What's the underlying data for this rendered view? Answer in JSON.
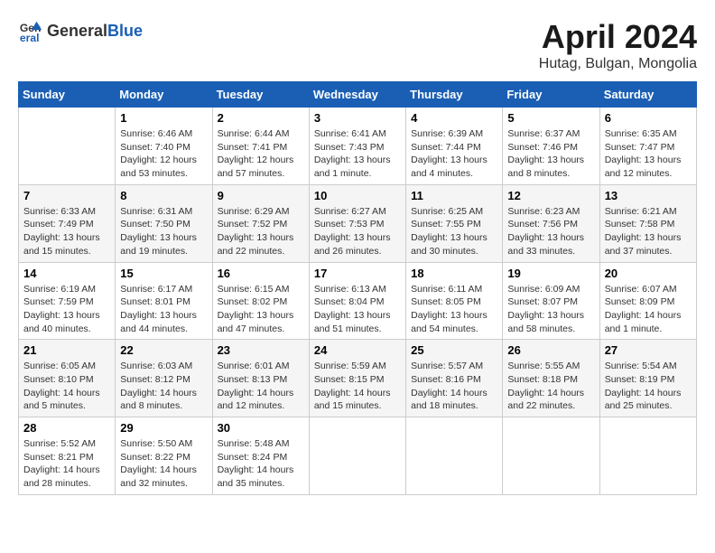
{
  "header": {
    "logo_general": "General",
    "logo_blue": "Blue",
    "month": "April 2024",
    "location": "Hutag, Bulgan, Mongolia"
  },
  "weekdays": [
    "Sunday",
    "Monday",
    "Tuesday",
    "Wednesday",
    "Thursday",
    "Friday",
    "Saturday"
  ],
  "weeks": [
    [
      {
        "day": null,
        "sunrise": null,
        "sunset": null,
        "daylight": null
      },
      {
        "day": "1",
        "sunrise": "Sunrise: 6:46 AM",
        "sunset": "Sunset: 7:40 PM",
        "daylight": "Daylight: 12 hours and 53 minutes."
      },
      {
        "day": "2",
        "sunrise": "Sunrise: 6:44 AM",
        "sunset": "Sunset: 7:41 PM",
        "daylight": "Daylight: 12 hours and 57 minutes."
      },
      {
        "day": "3",
        "sunrise": "Sunrise: 6:41 AM",
        "sunset": "Sunset: 7:43 PM",
        "daylight": "Daylight: 13 hours and 1 minute."
      },
      {
        "day": "4",
        "sunrise": "Sunrise: 6:39 AM",
        "sunset": "Sunset: 7:44 PM",
        "daylight": "Daylight: 13 hours and 4 minutes."
      },
      {
        "day": "5",
        "sunrise": "Sunrise: 6:37 AM",
        "sunset": "Sunset: 7:46 PM",
        "daylight": "Daylight: 13 hours and 8 minutes."
      },
      {
        "day": "6",
        "sunrise": "Sunrise: 6:35 AM",
        "sunset": "Sunset: 7:47 PM",
        "daylight": "Daylight: 13 hours and 12 minutes."
      }
    ],
    [
      {
        "day": "7",
        "sunrise": "Sunrise: 6:33 AM",
        "sunset": "Sunset: 7:49 PM",
        "daylight": "Daylight: 13 hours and 15 minutes."
      },
      {
        "day": "8",
        "sunrise": "Sunrise: 6:31 AM",
        "sunset": "Sunset: 7:50 PM",
        "daylight": "Daylight: 13 hours and 19 minutes."
      },
      {
        "day": "9",
        "sunrise": "Sunrise: 6:29 AM",
        "sunset": "Sunset: 7:52 PM",
        "daylight": "Daylight: 13 hours and 22 minutes."
      },
      {
        "day": "10",
        "sunrise": "Sunrise: 6:27 AM",
        "sunset": "Sunset: 7:53 PM",
        "daylight": "Daylight: 13 hours and 26 minutes."
      },
      {
        "day": "11",
        "sunrise": "Sunrise: 6:25 AM",
        "sunset": "Sunset: 7:55 PM",
        "daylight": "Daylight: 13 hours and 30 minutes."
      },
      {
        "day": "12",
        "sunrise": "Sunrise: 6:23 AM",
        "sunset": "Sunset: 7:56 PM",
        "daylight": "Daylight: 13 hours and 33 minutes."
      },
      {
        "day": "13",
        "sunrise": "Sunrise: 6:21 AM",
        "sunset": "Sunset: 7:58 PM",
        "daylight": "Daylight: 13 hours and 37 minutes."
      }
    ],
    [
      {
        "day": "14",
        "sunrise": "Sunrise: 6:19 AM",
        "sunset": "Sunset: 7:59 PM",
        "daylight": "Daylight: 13 hours and 40 minutes."
      },
      {
        "day": "15",
        "sunrise": "Sunrise: 6:17 AM",
        "sunset": "Sunset: 8:01 PM",
        "daylight": "Daylight: 13 hours and 44 minutes."
      },
      {
        "day": "16",
        "sunrise": "Sunrise: 6:15 AM",
        "sunset": "Sunset: 8:02 PM",
        "daylight": "Daylight: 13 hours and 47 minutes."
      },
      {
        "day": "17",
        "sunrise": "Sunrise: 6:13 AM",
        "sunset": "Sunset: 8:04 PM",
        "daylight": "Daylight: 13 hours and 51 minutes."
      },
      {
        "day": "18",
        "sunrise": "Sunrise: 6:11 AM",
        "sunset": "Sunset: 8:05 PM",
        "daylight": "Daylight: 13 hours and 54 minutes."
      },
      {
        "day": "19",
        "sunrise": "Sunrise: 6:09 AM",
        "sunset": "Sunset: 8:07 PM",
        "daylight": "Daylight: 13 hours and 58 minutes."
      },
      {
        "day": "20",
        "sunrise": "Sunrise: 6:07 AM",
        "sunset": "Sunset: 8:09 PM",
        "daylight": "Daylight: 14 hours and 1 minute."
      }
    ],
    [
      {
        "day": "21",
        "sunrise": "Sunrise: 6:05 AM",
        "sunset": "Sunset: 8:10 PM",
        "daylight": "Daylight: 14 hours and 5 minutes."
      },
      {
        "day": "22",
        "sunrise": "Sunrise: 6:03 AM",
        "sunset": "Sunset: 8:12 PM",
        "daylight": "Daylight: 14 hours and 8 minutes."
      },
      {
        "day": "23",
        "sunrise": "Sunrise: 6:01 AM",
        "sunset": "Sunset: 8:13 PM",
        "daylight": "Daylight: 14 hours and 12 minutes."
      },
      {
        "day": "24",
        "sunrise": "Sunrise: 5:59 AM",
        "sunset": "Sunset: 8:15 PM",
        "daylight": "Daylight: 14 hours and 15 minutes."
      },
      {
        "day": "25",
        "sunrise": "Sunrise: 5:57 AM",
        "sunset": "Sunset: 8:16 PM",
        "daylight": "Daylight: 14 hours and 18 minutes."
      },
      {
        "day": "26",
        "sunrise": "Sunrise: 5:55 AM",
        "sunset": "Sunset: 8:18 PM",
        "daylight": "Daylight: 14 hours and 22 minutes."
      },
      {
        "day": "27",
        "sunrise": "Sunrise: 5:54 AM",
        "sunset": "Sunset: 8:19 PM",
        "daylight": "Daylight: 14 hours and 25 minutes."
      }
    ],
    [
      {
        "day": "28",
        "sunrise": "Sunrise: 5:52 AM",
        "sunset": "Sunset: 8:21 PM",
        "daylight": "Daylight: 14 hours and 28 minutes."
      },
      {
        "day": "29",
        "sunrise": "Sunrise: 5:50 AM",
        "sunset": "Sunset: 8:22 PM",
        "daylight": "Daylight: 14 hours and 32 minutes."
      },
      {
        "day": "30",
        "sunrise": "Sunrise: 5:48 AM",
        "sunset": "Sunset: 8:24 PM",
        "daylight": "Daylight: 14 hours and 35 minutes."
      },
      {
        "day": null,
        "sunrise": null,
        "sunset": null,
        "daylight": null
      },
      {
        "day": null,
        "sunrise": null,
        "sunset": null,
        "daylight": null
      },
      {
        "day": null,
        "sunrise": null,
        "sunset": null,
        "daylight": null
      },
      {
        "day": null,
        "sunrise": null,
        "sunset": null,
        "daylight": null
      }
    ]
  ]
}
